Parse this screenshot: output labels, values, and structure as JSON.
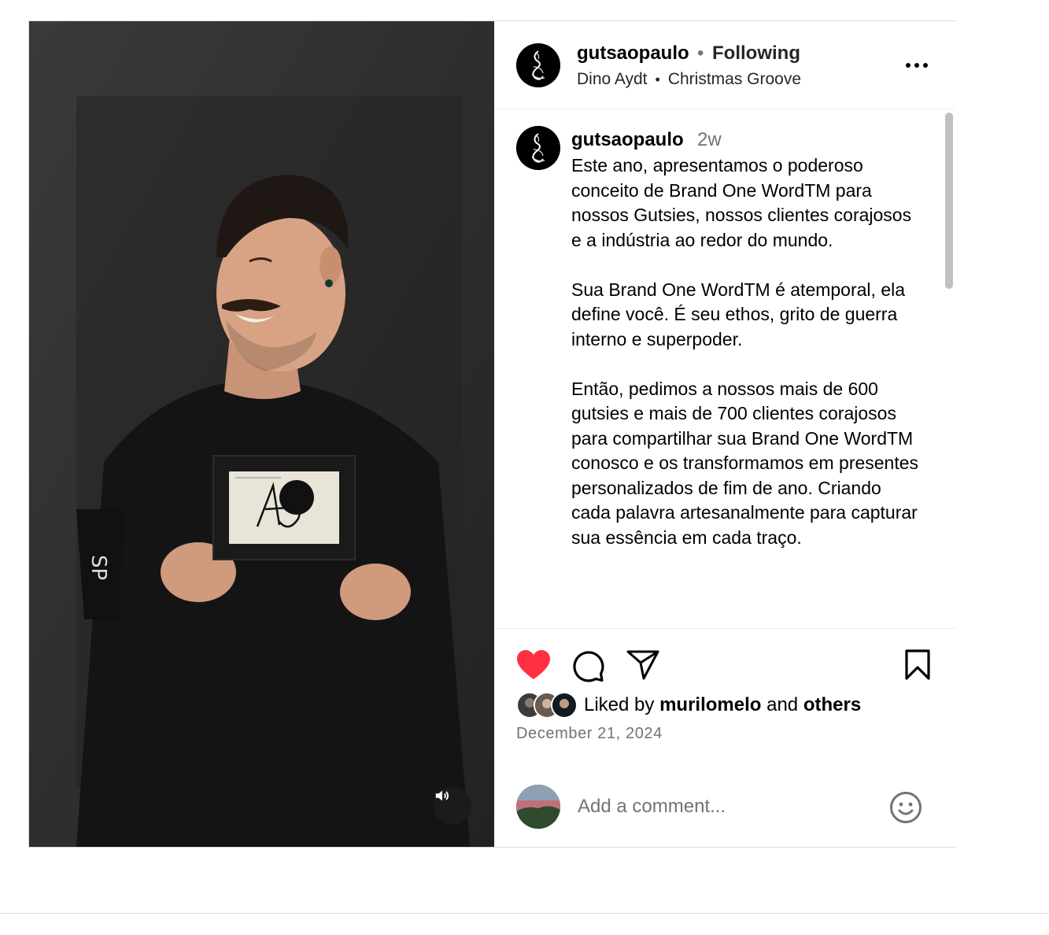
{
  "post": {
    "author": "gutsaopaulo",
    "follow_separator": "•",
    "follow_status": "Following",
    "audio_artist": "Dino Aydt",
    "audio_separator": "•",
    "audio_track": "Christmas Groove"
  },
  "caption": {
    "author": "gutsaopaulo",
    "time_ago": "2w",
    "paragraphs": [
      "Este ano, apresentamos o poderoso conceito de Brand One WordTM para nossos Gutsies, nossos clientes corajosos e a indústria ao redor do mundo.",
      "Sua Brand One WordTM é atemporal, ela define você. É seu ethos, grito de guerra interno e superpoder.",
      "Então, pedimos a nossos mais de 600 gutsies e mais de 700 clientes corajosos para compartilhar sua Brand One WordTM conosco e os transformamos em presentes personalizados de fim de ano. Criando cada palavra artesanalmente para capturar sua essência em cada traço."
    ]
  },
  "likes": {
    "prefix": "Liked by",
    "user": "murilomelo",
    "conjunction": "and",
    "others": "others"
  },
  "date": "December 21, 2024",
  "comment": {
    "placeholder": "Add a comment..."
  },
  "colors": {
    "like_red": "#ff3040",
    "muted_text": "#737373",
    "border": "#dbdbdb"
  },
  "icons": [
    "avatar-logo",
    "more-icon",
    "heart-icon",
    "comment-icon",
    "share-icon",
    "bookmark-icon",
    "emoji-icon",
    "sound-icon"
  ]
}
